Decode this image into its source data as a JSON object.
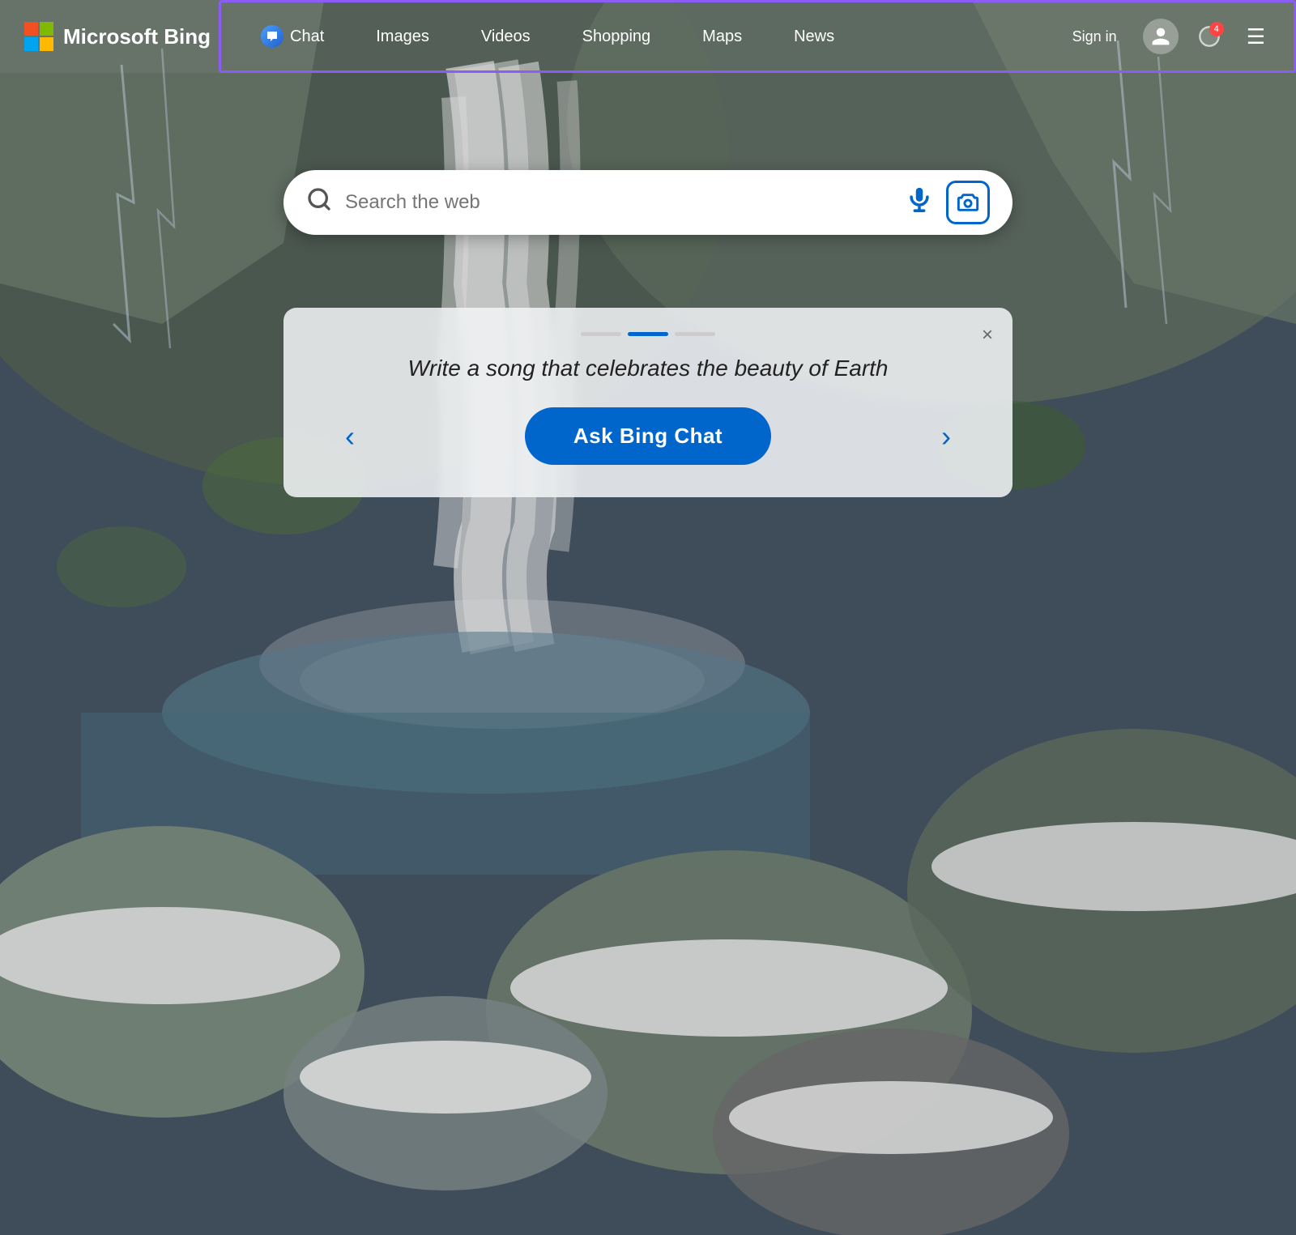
{
  "logo": {
    "text": "Microsoft Bing"
  },
  "nav": {
    "chat_label": "Chat",
    "images_label": "Images",
    "videos_label": "Videos",
    "shopping_label": "Shopping",
    "maps_label": "Maps",
    "news_label": "News",
    "sign_in_label": "Sign in",
    "notification_count": "4"
  },
  "search": {
    "placeholder": "Search the web"
  },
  "prompt_card": {
    "prompt_text": "Write a song that celebrates the beauty of Earth",
    "ask_button_label": "Ask Bing Chat",
    "close_label": "×",
    "prev_label": "‹",
    "next_label": "›",
    "dots": [
      {
        "active": false
      },
      {
        "active": true
      },
      {
        "active": false
      }
    ]
  }
}
